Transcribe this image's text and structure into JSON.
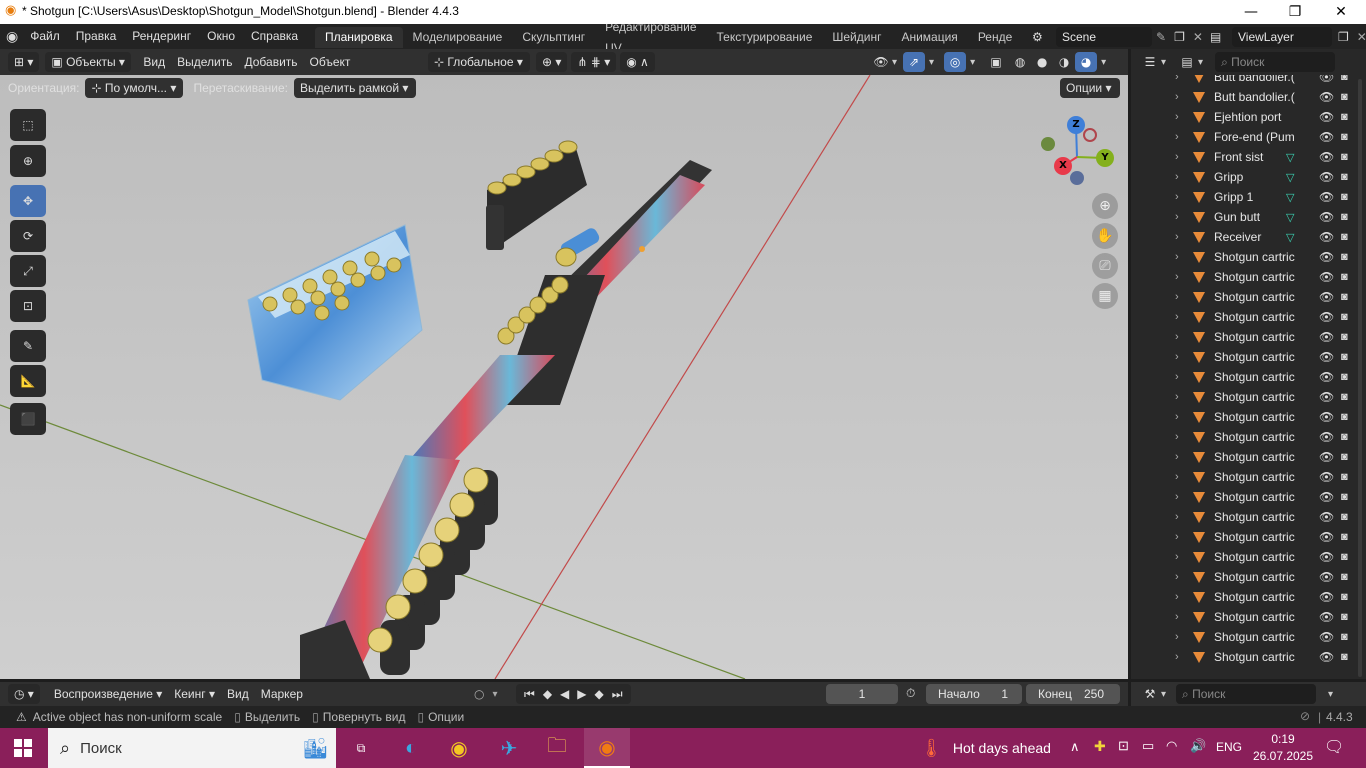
{
  "window": {
    "title": "* Shotgun [C:\\Users\\Asus\\Desktop\\Shotgun_Model\\Shotgun.blend] - Blender 4.4.3",
    "minimize": "—",
    "maximize": "❐",
    "close": "✕"
  },
  "menu": {
    "file": "Файл",
    "edit": "Правка",
    "render": "Рендеринг",
    "window": "Окно",
    "help": "Справка"
  },
  "workspaces": [
    "Планировка",
    "Моделирование",
    "Скульптинг",
    "Редактирование UV",
    "Текстурирование",
    "Шейдинг",
    "Анимация",
    "Ренде"
  ],
  "scene": {
    "name": "Scene",
    "view_layer": "ViewLayer"
  },
  "viewport_header": {
    "mode": "Объекты",
    "view": "Вид",
    "select": "Выделить",
    "add": "Добавить",
    "object": "Объект",
    "transform": "Глобальное"
  },
  "tool_settings": {
    "orientation_label": "Ориентация:",
    "orientation_value": "По умолч...",
    "drag_label": "Перетаскивание:",
    "drag_value": "Выделить рамкой",
    "options": "Опции"
  },
  "gizmo": {
    "x": "X",
    "y": "Y",
    "z": "Z"
  },
  "outliner": {
    "search_placeholder": "Поиск",
    "items": [
      {
        "name": "Butt bandolier.(",
        "mesh": false
      },
      {
        "name": "Butt bandolier.(",
        "mesh": false
      },
      {
        "name": "Ejehtion port",
        "mesh": false
      },
      {
        "name": "Fore-end (Pum",
        "mesh": false
      },
      {
        "name": "Front sist",
        "mesh": true
      },
      {
        "name": "Gripp",
        "mesh": true
      },
      {
        "name": "Gripp 1",
        "mesh": true
      },
      {
        "name": "Gun butt",
        "mesh": true
      },
      {
        "name": "Receiver",
        "mesh": true
      },
      {
        "name": "Shotgun cartric",
        "mesh": false
      },
      {
        "name": "Shotgun cartric",
        "mesh": false
      },
      {
        "name": "Shotgun cartric",
        "mesh": false
      },
      {
        "name": "Shotgun cartric",
        "mesh": false
      },
      {
        "name": "Shotgun cartric",
        "mesh": false
      },
      {
        "name": "Shotgun cartric",
        "mesh": false
      },
      {
        "name": "Shotgun cartric",
        "mesh": false
      },
      {
        "name": "Shotgun cartric",
        "mesh": false
      },
      {
        "name": "Shotgun cartric",
        "mesh": false
      },
      {
        "name": "Shotgun cartric",
        "mesh": false
      },
      {
        "name": "Shotgun cartric",
        "mesh": false
      },
      {
        "name": "Shotgun cartric",
        "mesh": false
      },
      {
        "name": "Shotgun cartric",
        "mesh": false
      },
      {
        "name": "Shotgun cartric",
        "mesh": false
      },
      {
        "name": "Shotgun cartric",
        "mesh": false
      },
      {
        "name": "Shotgun cartric",
        "mesh": false
      },
      {
        "name": "Shotgun cartric",
        "mesh": false
      },
      {
        "name": "Shotgun cartric",
        "mesh": false
      },
      {
        "name": "Shotgun cartric",
        "mesh": false
      },
      {
        "name": "Shotgun cartric",
        "mesh": false
      },
      {
        "name": "Shotgun cartric",
        "mesh": false
      }
    ]
  },
  "timeline": {
    "playback": "Воспроизведение",
    "keying": "Кеинг",
    "view": "Вид",
    "marker": "Маркер",
    "current_frame": "1",
    "start_label": "Начало",
    "start_value": "1",
    "end_label": "Конец",
    "end_value": "250"
  },
  "properties_search": "Поиск",
  "statusbar": {
    "warning": "Active object has non-uniform scale",
    "select": "Выделить",
    "rotate": "Повернуть вид",
    "options": "Опции",
    "version": "4.4.3"
  },
  "taskbar": {
    "search": "Поиск",
    "weather": "Hot days ahead",
    "lang": "ENG",
    "time": "0:19",
    "date": "26.07.2025"
  },
  "colors": {
    "accent": "#4772b3",
    "taskbar": "#8a1f5a",
    "object_icon": "#e88b3a",
    "mesh_icon": "#3bd4b4"
  }
}
